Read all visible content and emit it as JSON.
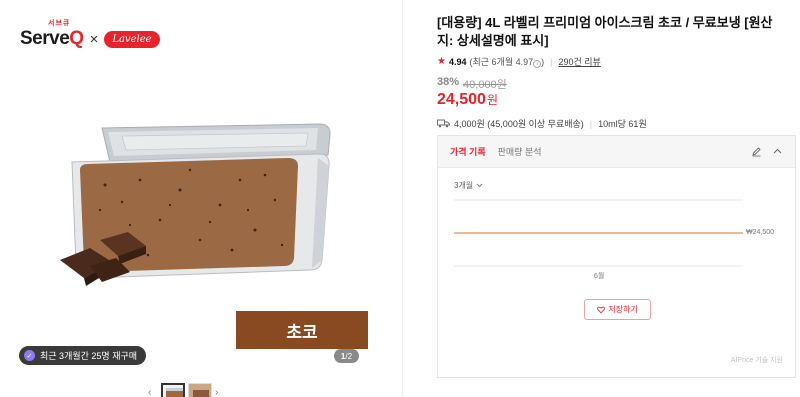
{
  "brand": {
    "serveq_small": "서브큐",
    "serveq_main": "Serve",
    "serveq_q": "Q",
    "times": "×",
    "partner": "Lavelee"
  },
  "image": {
    "flavor_banner": "초코",
    "repurchase_icon": "repurchase-badge-icon",
    "repurchase_text": "최근 3개월간 25명 재구매",
    "pager_current": "1",
    "pager_sep": "/",
    "pager_total": "2",
    "prev_icon": "‹",
    "next_icon": "›"
  },
  "product": {
    "title": "[대용량] 4L 라벨리 프리미엄 아이스크림 초코 / 무료보냉 [원산지: 상세설명에 표시]",
    "rating": {
      "star": "★",
      "score": "4.94",
      "recent_prefix": "(최근 6개월 4.97",
      "info": "i",
      "recent_suffix": ")",
      "reviews": "290건 리뷰"
    },
    "discount_pct": "38%",
    "original_price": "40,000원",
    "price_value": "24,500",
    "price_unit": "원",
    "delivery": {
      "fee": "4,000원 (45,000원 이상 무료배송)",
      "unit_price": "10ml당 61원"
    }
  },
  "panel": {
    "tab_active": "가격 기록",
    "tab_other": "판매량 분석",
    "period": "3개월",
    "price_line_label": "₩24,500",
    "month_label": "6월",
    "save_button": "저장하기",
    "credit": "AIPrice 기술 지원"
  },
  "colors": {
    "accent": "#e8232d",
    "price_line": "#f0a070",
    "flavor_banner": "#8a4a21"
  }
}
